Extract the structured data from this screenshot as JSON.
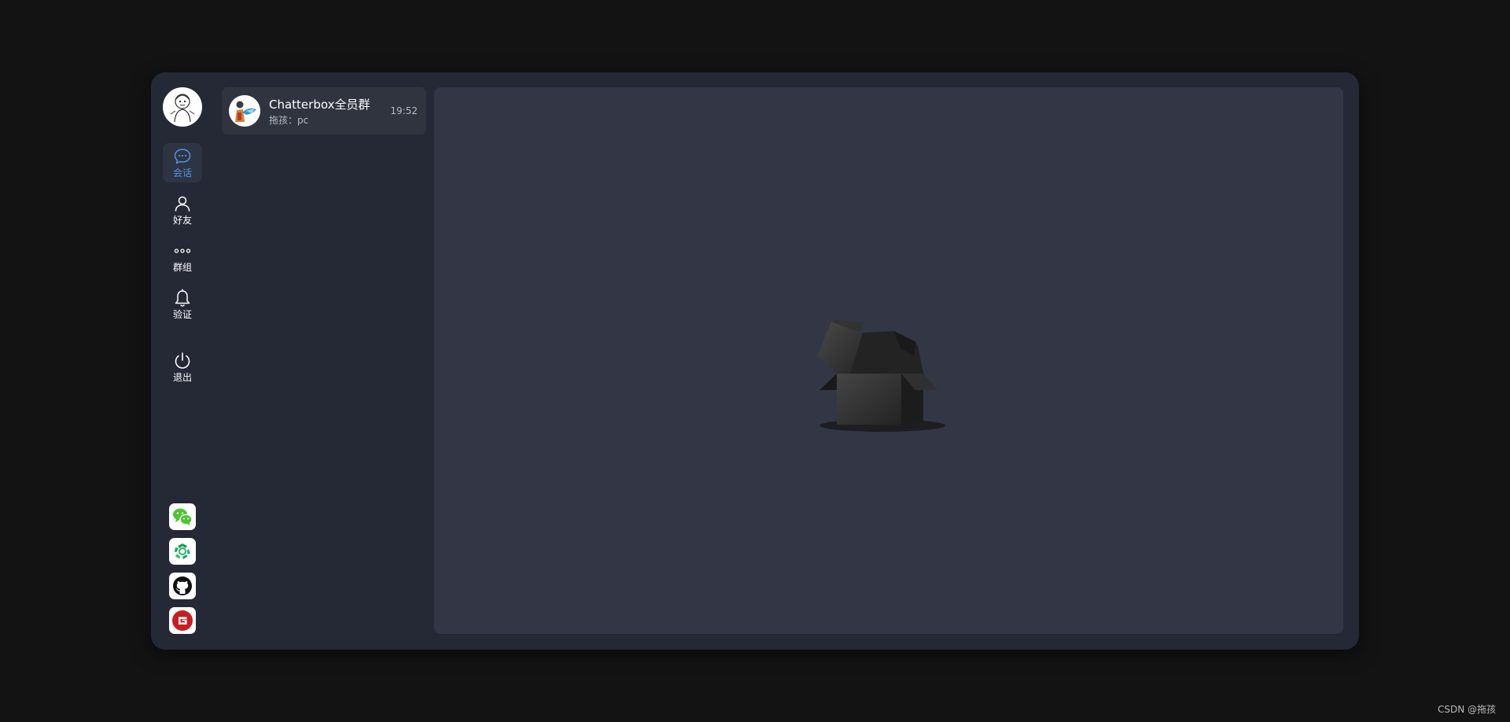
{
  "sidebar": {
    "nav": [
      {
        "label": "会话",
        "icon": "chat-bubble-icon",
        "active": true
      },
      {
        "label": "好友",
        "icon": "user-icon",
        "active": false
      },
      {
        "label": "群组",
        "icon": "more-dots-icon",
        "active": false
      },
      {
        "label": "验证",
        "icon": "bell-icon",
        "active": false
      },
      {
        "label": "退出",
        "icon": "power-icon",
        "active": false
      }
    ],
    "social": [
      {
        "name": "wechat",
        "icon": "wechat-icon"
      },
      {
        "name": "recycle",
        "icon": "recycle-icon"
      },
      {
        "name": "github",
        "icon": "github-icon"
      },
      {
        "name": "gitee",
        "icon": "gitee-icon"
      }
    ]
  },
  "chat_list": [
    {
      "name": "Chatterbox全员群",
      "preview": "拖孩：pc",
      "time": "19:52"
    }
  ],
  "colors": {
    "accent": "#4e95ea",
    "app_bg": "#252936",
    "panel_bg": "#333645",
    "page_bg": "#131313"
  },
  "watermark": "CSDN @拖孩"
}
